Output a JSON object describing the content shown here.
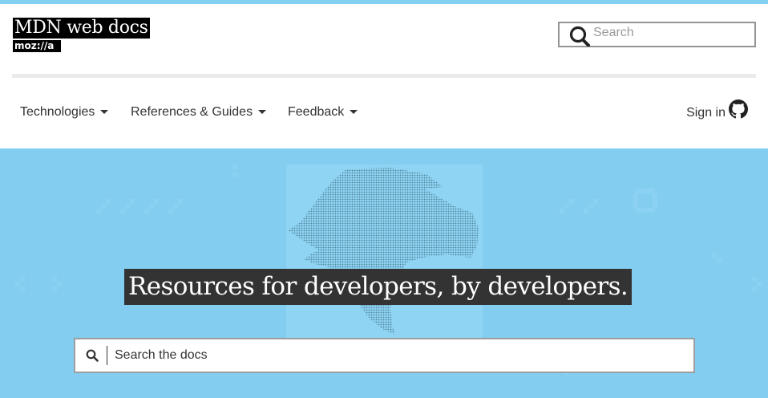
{
  "brand": {
    "title": "MDN web docs",
    "sub": "moz://a"
  },
  "header_search": {
    "placeholder": "Search"
  },
  "nav": {
    "items": [
      {
        "label": "Technologies"
      },
      {
        "label": "References & Guides"
      },
      {
        "label": "Feedback"
      }
    ],
    "signin_label": "Sign in"
  },
  "hero": {
    "title": "Resources for developers, by developers.",
    "search_placeholder": "Search the docs"
  },
  "colors": {
    "top_stripe": "#83d0f2",
    "hero_bg": "#83cdf1",
    "title_bg": "#333333"
  },
  "icons": [
    "search-icon",
    "caret-down-icon",
    "github-icon",
    "dinosaur-illustration"
  ]
}
